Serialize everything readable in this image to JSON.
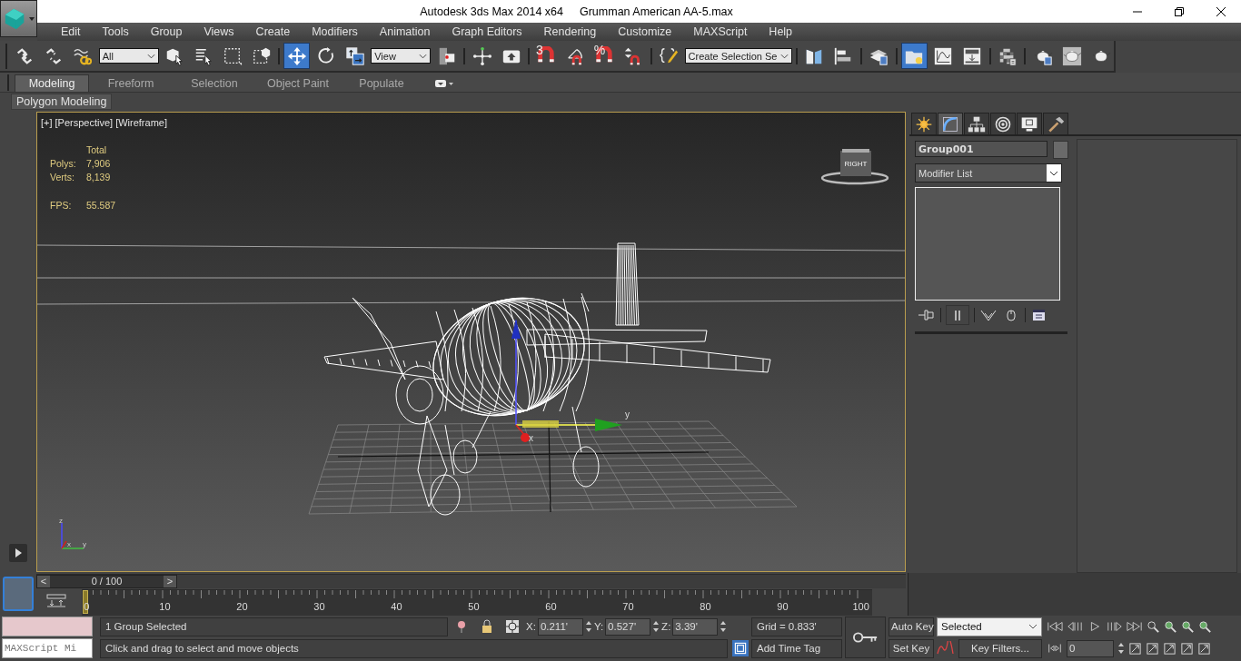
{
  "window": {
    "title_app": "Autodesk 3ds Max  2014 x64",
    "title_file": "Grumman American AA-5.max"
  },
  "menu": [
    "Edit",
    "Tools",
    "Group",
    "Views",
    "Create",
    "Modifiers",
    "Animation",
    "Graph Editors",
    "Rendering",
    "Customize",
    "MAXScript",
    "Help"
  ],
  "toolbar": {
    "items": [
      {
        "kind": "link",
        "selected": false
      },
      {
        "kind": "unlink",
        "selected": false
      },
      {
        "kind": "bind",
        "selected": false
      },
      {
        "kind": "dropdown",
        "value": "All"
      },
      {
        "kind": "select",
        "selected": false
      },
      {
        "kind": "select-name",
        "selected": false
      },
      {
        "kind": "rect-region",
        "selected": false
      },
      {
        "kind": "window-crossing",
        "selected": false
      },
      {
        "kind": "separator"
      },
      {
        "kind": "move",
        "selected": true
      },
      {
        "kind": "rotate",
        "selected": false
      },
      {
        "kind": "scale",
        "selected": false
      },
      {
        "kind": "dropdown",
        "value": "View"
      },
      {
        "kind": "pivot",
        "selected": false
      },
      {
        "kind": "separator"
      },
      {
        "kind": "manipulate",
        "selected": false
      },
      {
        "kind": "keyboard",
        "selected": false
      },
      {
        "kind": "separator"
      },
      {
        "kind": "snap",
        "glyph": "3",
        "selected": false
      },
      {
        "kind": "angle-snap",
        "selected": false
      },
      {
        "kind": "snap",
        "glyph": "%",
        "selected": false
      },
      {
        "kind": "spinner-snap",
        "selected": false
      },
      {
        "kind": "separator"
      },
      {
        "kind": "named-edit",
        "selected": false
      },
      {
        "kind": "dropdown",
        "value": "Create Selection Se"
      },
      {
        "kind": "separator"
      },
      {
        "kind": "mirror",
        "selected": false
      },
      {
        "kind": "align",
        "selected": false
      },
      {
        "kind": "separator"
      },
      {
        "kind": "layers",
        "selected": false
      },
      {
        "kind": "separator"
      },
      {
        "kind": "explorer",
        "selected": true
      },
      {
        "kind": "curve",
        "selected": false
      },
      {
        "kind": "schematic",
        "selected": false
      },
      {
        "kind": "separator"
      },
      {
        "kind": "material"
      },
      {
        "kind": "separator"
      },
      {
        "kind": "render-setup",
        "selected": false
      },
      {
        "kind": "frame-window",
        "selected": false
      },
      {
        "kind": "render",
        "selected": false
      }
    ]
  },
  "ribbon": {
    "tabs": [
      {
        "label": "Modeling",
        "selected": true
      },
      {
        "label": "Freeform",
        "selected": false
      },
      {
        "label": "Selection",
        "selected": false
      },
      {
        "label": "Object Paint",
        "selected": false
      },
      {
        "label": "Populate",
        "selected": false
      }
    ],
    "panel": "Polygon Modeling"
  },
  "viewport": {
    "labels": [
      "[+]",
      "[Perspective]",
      "[Wireframe]"
    ],
    "stats": {
      "heading": "Total",
      "rows": [
        {
          "label": "Polys:",
          "value": "7,906"
        },
        {
          "label": "Verts:",
          "value": "8,139"
        }
      ],
      "fps_label": "FPS:",
      "fps": "55.587"
    },
    "viewcube": "RIGHT",
    "gizmo": {
      "x": "x",
      "y": "y"
    },
    "tripod": {
      "x": "x",
      "y": "y",
      "z": "z"
    }
  },
  "command_panel": {
    "tabs": [
      {
        "kind": "create",
        "selected": false
      },
      {
        "kind": "modify",
        "selected": true
      },
      {
        "kind": "hierarchy",
        "selected": false
      },
      {
        "kind": "motion",
        "selected": false
      },
      {
        "kind": "display",
        "selected": false
      },
      {
        "kind": "utilities",
        "selected": false
      }
    ],
    "object_name": "Group001",
    "modifier_list": "Modifier List"
  },
  "time_slider": {
    "prev": "<",
    "label": "0 / 100",
    "next": ">",
    "level": 0
  },
  "track_bar": {
    "ticks": [
      "0",
      "10",
      "20",
      "30",
      "40",
      "50",
      "60",
      "70",
      "80",
      "90",
      "100"
    ]
  },
  "status": {
    "listener": "MAXScript Mi",
    "selection": "1 Group Selected",
    "coords": [
      {
        "label": "X:",
        "value": "0.211'"
      },
      {
        "label": "Y:",
        "value": "0.527'"
      },
      {
        "label": "Z:",
        "value": "3.39'"
      }
    ],
    "grid": "Grid = 0.833'",
    "prompt": "Click and drag to select and move objects",
    "time_tag": "Add Time Tag"
  },
  "animation": {
    "auto_key": "Auto Key",
    "key_mode": "Selected",
    "set_key": "Set Key",
    "key_filters": "Key Filters...",
    "frame": "0"
  }
}
